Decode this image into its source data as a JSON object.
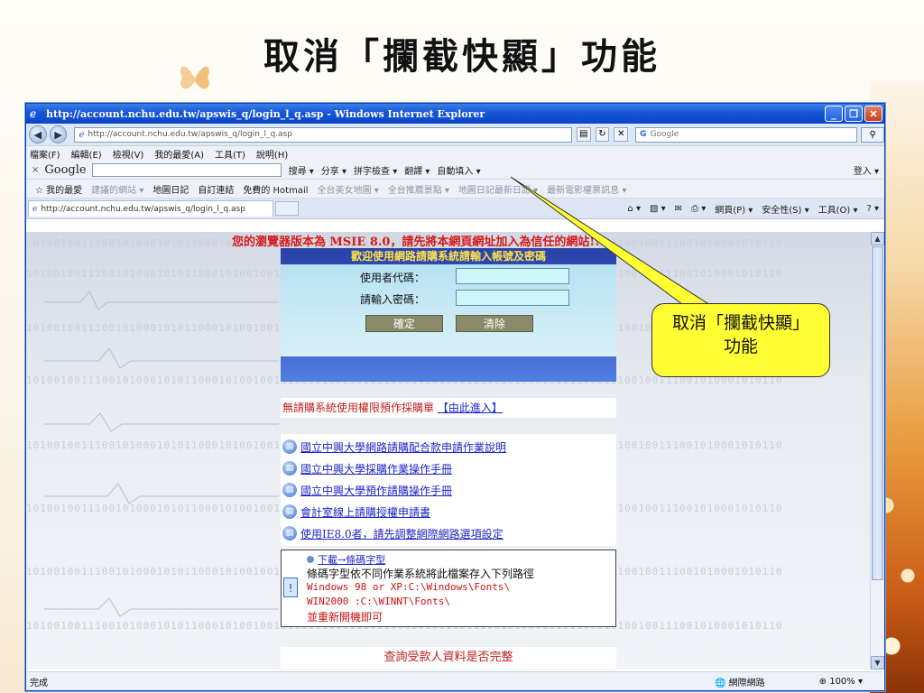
{
  "slide": {
    "title": "取消「攔截快顯」功能",
    "callout_line1": "取消「攔截快顯」",
    "callout_line2": "功能"
  },
  "window": {
    "title": "http://account.nchu.edu.tw/apswis_q/login_l_q.asp - Windows Internet Explorer",
    "minimize_label": "_",
    "restore_label": "❐",
    "close_label": "✕"
  },
  "addressbar": {
    "url": "http://account.nchu.edu.tw/apswis_q/login_l_q.asp",
    "search_placeholder": "Google",
    "search_g": "G"
  },
  "menubar": {
    "items": [
      "檔案(F)",
      "編輯(E)",
      "檢視(V)",
      "我的最愛(A)",
      "工具(T)",
      "說明(H)"
    ]
  },
  "googlebar": {
    "close": "×",
    "logo": "Google",
    "items": [
      "搜尋 ▾",
      "分享 ▾",
      "拼字檢查 ▾",
      "翻譯 ▾",
      "自動填入 ▾",
      "登入 ▾"
    ]
  },
  "favbar": {
    "favorites": "我的最愛",
    "items": [
      "建議的網站 ▾",
      "地圖日記",
      "自訂連結",
      "免費的 Hotmail",
      "全台美女地圖 ▾",
      "全台推薦景點 ▾",
      "地圖日記最新日記 ▾",
      "最新電影權票訊息 ▾"
    ]
  },
  "tabbar": {
    "tab_title": "http://account.nchu.edu.tw/apswis_q/login_l_q.asp",
    "commands": [
      "網頁(P) ▾",
      "安全性(S) ▾",
      "工具(O) ▾"
    ]
  },
  "page": {
    "binary_line": "10100100111001010001010110001010010011100101000101011000101001001110010100010101100010100100111001010001010110",
    "warning": "您的瀏覽器版本為 MSIE 8.0，請先將本網頁網址加入為信任的網站!!!",
    "login_header": "歡迎使用網路請購系統請輸入帳號及密碼",
    "user_label": "使用者代碼：",
    "pass_label": "請輸入密碼：",
    "ok_label": "確定",
    "clear_label": "清除",
    "noreq_text": "無請購系統使用權限預作採購單",
    "noreq_link": "【由此進入】",
    "docs": [
      "國立中興大學網路請購配合款申請作業說明",
      "國立中興大學採購作業操作手冊",
      "國立中興大學預作請購操作手冊",
      "會計室線上請購授權申請書",
      "使用IE8.0者，請先調整網際網路選項設定"
    ],
    "font_download": "下載→條碼字型",
    "font_desc": "條碼字型依不同作業系統將此檔案存入下列路徑",
    "font_path1": "Windows 98 or XP:C:\\Windows\\Fonts\\",
    "font_path2": "WIN2000 :C:\\WINNT\\Fonts\\",
    "font_reboot": "並重新開機即可",
    "check_text": "查詢受款人資料是否完整"
  },
  "statusbar": {
    "status": "完成",
    "zone": "網際網路",
    "zoom": "100%"
  }
}
